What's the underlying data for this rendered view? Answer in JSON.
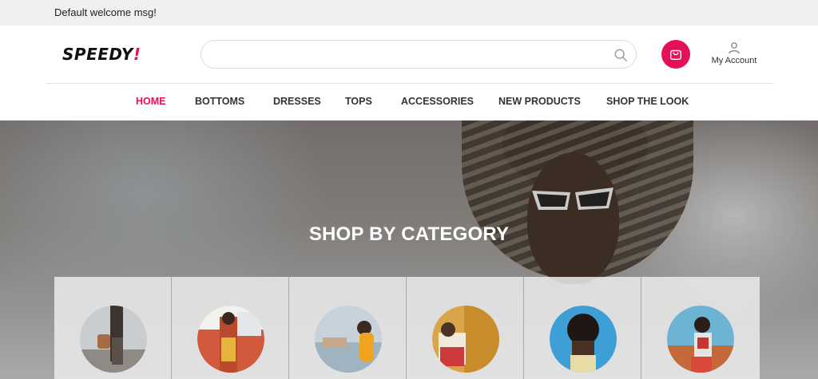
{
  "topbar": {
    "welcome": "Default welcome msg!"
  },
  "header": {
    "logo": {
      "text": "SPEEDY",
      "accent": "!"
    },
    "search": {
      "value": "",
      "placeholder": ""
    },
    "account_label": "My Account"
  },
  "nav": {
    "items": [
      "HOME",
      "BOTTOMS",
      "DRESSES",
      "TOPS",
      "ACCESSORIES",
      "NEW PRODUCTS",
      "SHOP THE LOOK"
    ],
    "active": "HOME"
  },
  "hero": {
    "title": "SHOP BY CATEGORY"
  },
  "categories": [
    {
      "icon": "category-photo-1"
    },
    {
      "icon": "category-photo-2"
    },
    {
      "icon": "category-photo-3"
    },
    {
      "icon": "category-photo-4"
    },
    {
      "icon": "category-photo-5"
    },
    {
      "icon": "category-photo-6"
    }
  ],
  "colors": {
    "accent": "#e4115a",
    "topbar": "#f0f0f0",
    "text": "#333333"
  }
}
